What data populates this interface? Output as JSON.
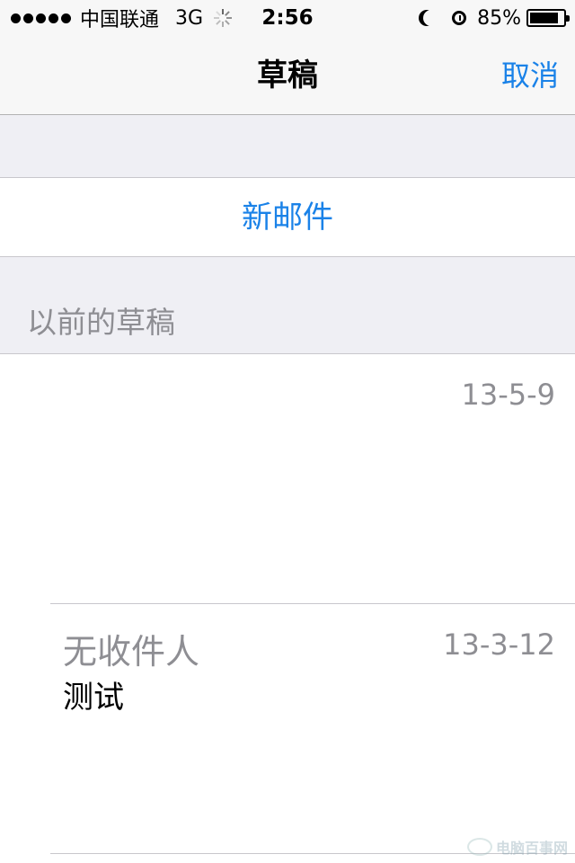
{
  "status_bar": {
    "carrier": "中国联通",
    "network": "3G",
    "time": "2:56",
    "battery_percent": "85%",
    "battery_level": 0.85,
    "icons": [
      "signal-icon",
      "activity-icon",
      "moon-icon",
      "alarm-icon",
      "battery-icon"
    ]
  },
  "nav": {
    "title": "草稿",
    "cancel_label": "取消"
  },
  "new_mail_label": "新邮件",
  "section_header": "以前的草稿",
  "drafts": [
    {
      "recipient": "",
      "subject": "",
      "date": "13-5-9"
    },
    {
      "recipient": "无收件人",
      "subject": "测试",
      "date": "13-3-12"
    }
  ],
  "watermark": "电脑百事网",
  "colors": {
    "accent": "#1a82e8",
    "secondary_text": "#8e8e93",
    "group_background": "#efeff4",
    "separator": "#c8c7cc"
  }
}
